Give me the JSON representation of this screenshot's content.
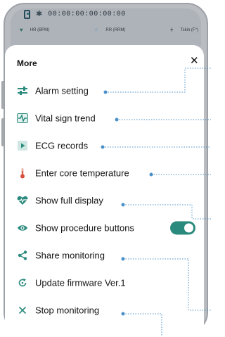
{
  "status_bar": {
    "device_id": "00:00:00:00:00:00",
    "vitals": [
      {
        "label": "HR (BPM)"
      },
      {
        "label": "RR (RRM)"
      },
      {
        "label": "Tskin (F°)"
      }
    ]
  },
  "sheet": {
    "title": "More",
    "close_symbol": "✕",
    "items": [
      {
        "label": "Alarm setting",
        "icon": "sliders-icon"
      },
      {
        "label": "Vital sign trend",
        "icon": "heart-trend-icon"
      },
      {
        "label": "ECG records",
        "icon": "play-icon"
      },
      {
        "label": "Enter core temperature",
        "icon": "thermometer-icon"
      },
      {
        "label": "Show full display",
        "icon": "heart-pulse-icon"
      },
      {
        "label": "Show procedure buttons",
        "icon": "eye-icon",
        "toggle_on": true
      },
      {
        "label": "Share monitoring",
        "icon": "share-icon"
      },
      {
        "label": "Update firmware Ver.1",
        "icon": "refresh-icon"
      },
      {
        "label": "Stop monitoring",
        "icon": "close-icon"
      }
    ]
  },
  "colors": {
    "accent": "#2A8A7D",
    "annotation": "#4A90C8",
    "thermometer": "#D64F3C"
  }
}
